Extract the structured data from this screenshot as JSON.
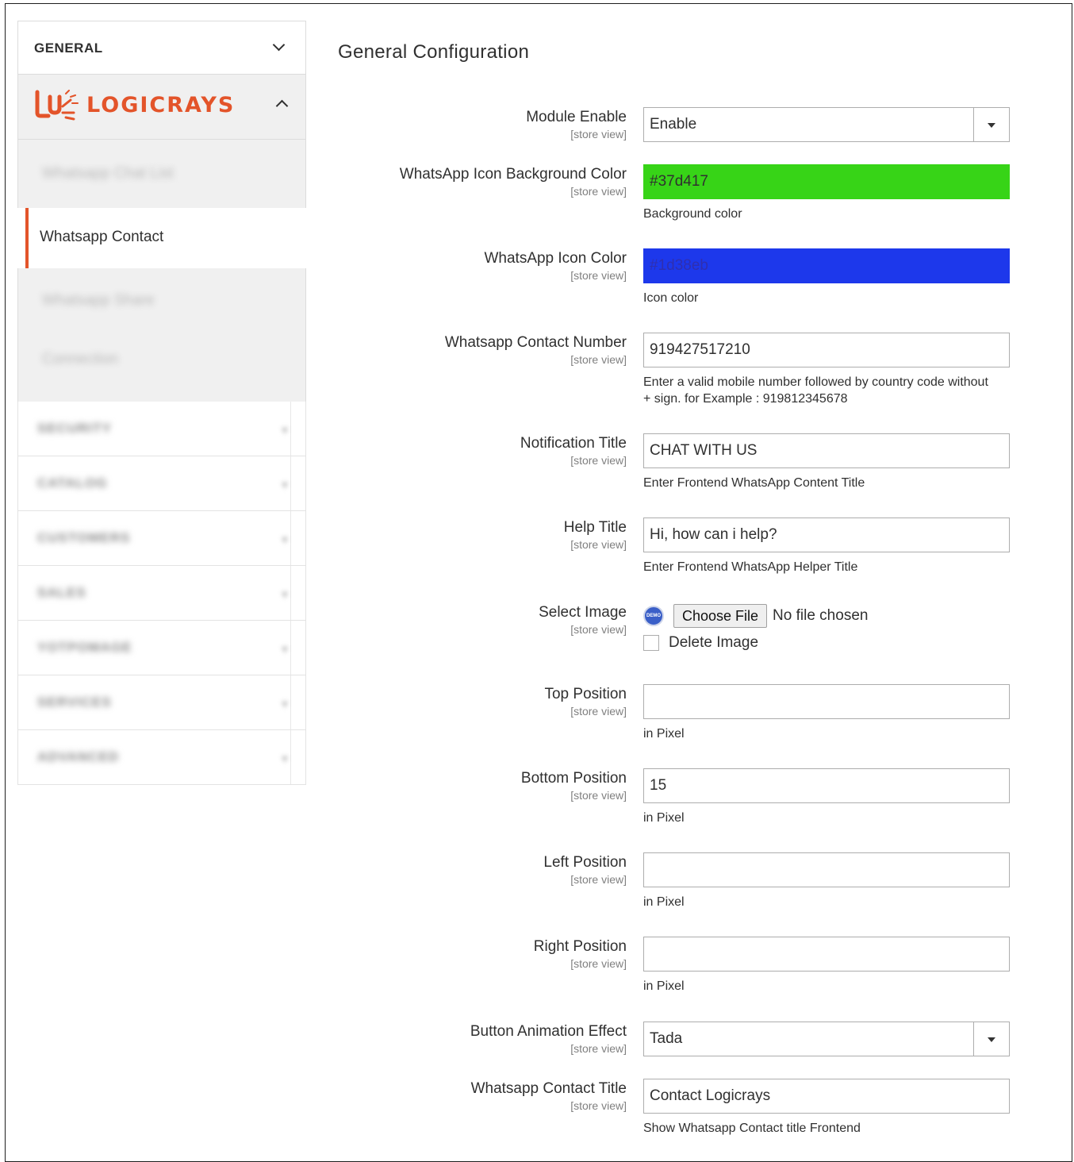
{
  "sidebar": {
    "general_title": "GENERAL",
    "logo_text": "LOGICRAYS",
    "active_item": "Whatsapp Contact"
  },
  "main": {
    "title": "General Configuration",
    "scope_label": "[store view]",
    "fields": {
      "module_enable": {
        "label": "Module Enable",
        "value": "Enable"
      },
      "icon_bg": {
        "label": "WhatsApp Icon Background Color",
        "value": "#37d417",
        "note": "Background color",
        "color": "#37d417"
      },
      "icon_color": {
        "label": "WhatsApp Icon Color",
        "value": "#1d38eb",
        "note": "Icon color",
        "color": "#1d38eb"
      },
      "contact_number": {
        "label": "Whatsapp Contact Number",
        "value": "919427517210",
        "note_line1": "Enter a valid mobile number followed by country code without",
        "note_line2": "+ sign. for Example : 919812345678"
      },
      "notification_title": {
        "label": "Notification Title",
        "value": "CHAT WITH US",
        "note": "Enter Frontend WhatsApp Content Title"
      },
      "help_title": {
        "label": "Help Title",
        "value": "Hi, how can i help?",
        "note": "Enter Frontend WhatsApp Helper Title"
      },
      "select_image": {
        "label": "Select Image",
        "button": "Choose File",
        "status": "No file chosen",
        "delete_label": "Delete Image"
      },
      "top_position": {
        "label": "Top Position",
        "value": "",
        "note": "in Pixel"
      },
      "bottom_position": {
        "label": "Bottom Position",
        "value": "15",
        "note": "in Pixel"
      },
      "left_position": {
        "label": "Left Position",
        "value": "",
        "note": "in Pixel"
      },
      "right_position": {
        "label": "Right Position",
        "value": "",
        "note": "in Pixel"
      },
      "animation": {
        "label": "Button Animation Effect",
        "value": "Tada"
      },
      "contact_title": {
        "label": "Whatsapp Contact Title",
        "value": "Contact Logicrays",
        "note": "Show Whatsapp Contact title Frontend"
      }
    }
  }
}
